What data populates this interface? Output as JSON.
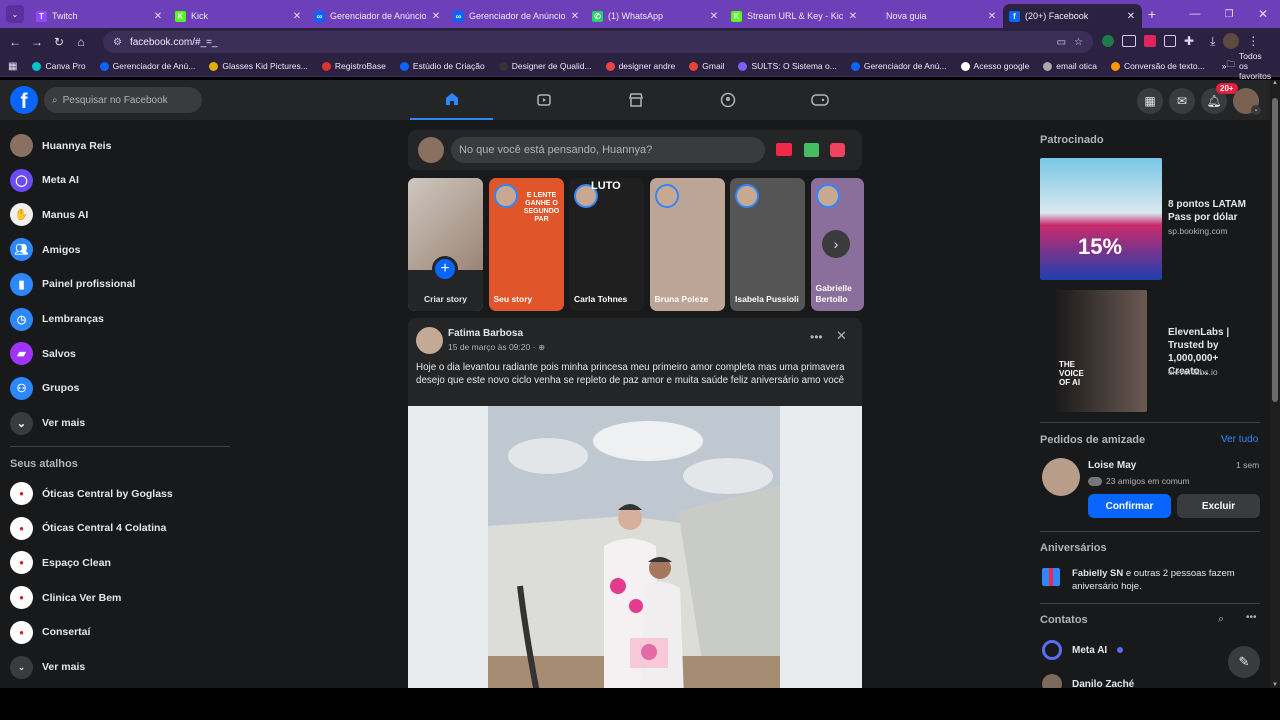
{
  "browser": {
    "tabs": [
      {
        "title": "Twitch",
        "icon_color": "#9146ff",
        "icon": "T"
      },
      {
        "title": "Kick",
        "icon_color": "#53fc18",
        "icon": "K"
      },
      {
        "title": "Gerenciador de Anúncios",
        "icon_color": "#0866ff",
        "icon": "∞"
      },
      {
        "title": "Gerenciador de Anúncios",
        "icon_color": "#0866ff",
        "icon": "∞"
      },
      {
        "title": "(1) WhatsApp",
        "icon_color": "#25d366",
        "icon": "✆"
      },
      {
        "title": "Stream URL & Key - Kick",
        "icon_color": "#53fc18",
        "icon": "K"
      },
      {
        "title": "Nova guia",
        "icon_color": "#6d3fb8",
        "icon": ""
      },
      {
        "title": "(20+) Facebook",
        "icon_color": "#0866ff",
        "icon": "f"
      }
    ],
    "url": "facebook.com/#_=_",
    "bookmarks": [
      {
        "label": "Canva Pro",
        "color": "#00c4cc"
      },
      {
        "label": "Gerenciador de Anú...",
        "color": "#0866ff"
      },
      {
        "label": "Glasses Kid Pictures...",
        "color": "#e0b000"
      },
      {
        "label": "RegistroBase",
        "color": "#d33"
      },
      {
        "label": "Estúdio de Criação",
        "color": "#0866ff"
      },
      {
        "label": "Designer de Qualid...",
        "color": "#333"
      },
      {
        "label": "designer andre",
        "color": "#e44"
      },
      {
        "label": "Gmail",
        "color": "#ea4335"
      },
      {
        "label": "SULTS: O Sistema o...",
        "color": "#7b61ff"
      },
      {
        "label": "Gerenciador de Anú...",
        "color": "#0866ff"
      },
      {
        "label": "Acesso google",
        "color": "#fff"
      },
      {
        "label": "email otica",
        "color": "#aaa"
      },
      {
        "label": "Conversão de texto...",
        "color": "#f90"
      }
    ],
    "bookmarks_more": "»",
    "all_favorites": "Todos os favoritos"
  },
  "facebook": {
    "search_placeholder": "Pesquisar no Facebook",
    "notification_count": "20+",
    "sidebar": [
      {
        "label": "Huannya Reis",
        "icon": "avatar",
        "color": "#8a7060"
      },
      {
        "label": "Meta AI",
        "icon": "meta-ai-icon",
        "color": "#6b4cf6"
      },
      {
        "label": "Manus AI",
        "icon": "manus-icon",
        "color": "#f0f0f0"
      },
      {
        "label": "Amigos",
        "icon": "friends-icon",
        "color": "#2d88ff"
      },
      {
        "label": "Painel profissional",
        "icon": "dashboard-icon",
        "color": "#2d88ff"
      },
      {
        "label": "Lembranças",
        "icon": "memories-icon",
        "color": "#2d88ff"
      },
      {
        "label": "Salvos",
        "icon": "saved-icon",
        "color": "#a033ff"
      },
      {
        "label": "Grupos",
        "icon": "groups-icon",
        "color": "#2d88ff"
      },
      {
        "label": "Ver mais",
        "icon": "chevron-down-icon",
        "color": "#3a3b3c"
      }
    ],
    "shortcuts_title": "Seus atalhos",
    "shortcuts": [
      {
        "label": "Óticas Central by Goglass",
        "color": "#fff"
      },
      {
        "label": "Óticas Central 4 Colatina",
        "color": "#fff"
      },
      {
        "label": "Espaço Clean",
        "color": "#fff"
      },
      {
        "label": "Clinica Ver Bem",
        "color": "#fff"
      },
      {
        "label": "Consertaí",
        "color": "#fff"
      },
      {
        "label": "Ver mais",
        "color": "#3a3b3c"
      }
    ],
    "composer_placeholder": "No que você está pensando, Huannya?",
    "stories": [
      {
        "name": "Criar story",
        "bg": "#d8d2cc"
      },
      {
        "name": "Seu story",
        "bg": "#e0562a"
      },
      {
        "name": "Carla Tohnes",
        "bg": "#1f1f1f"
      },
      {
        "name": "Bruna Poleze",
        "bg": "#bda596"
      },
      {
        "name": "Isabela Pussioli",
        "bg": "#555"
      },
      {
        "name": "Gabrielle Bertollo",
        "bg": "#8a6f9c"
      }
    ],
    "story_overlay": {
      "seu_story_text": "E LENTE GANHE O SEGUNDO PAR",
      "carla_title": "LUTO"
    },
    "post": {
      "author": "Fatima Barbosa",
      "date": "15 de março às 09:20 ·",
      "text": "Hoje o dia levantou radiante pois minha princesa meu primeiro amor completa mas uma primavera desejo que este novo ciclo venha se repleto de paz amor e muita saúde feliz aniversário amo você"
    },
    "right": {
      "sponsored_title": "Patrocinado",
      "ads": [
        {
          "title": "8 pontos LATAM Pass por dólar",
          "domain": "sp.booking.com",
          "promo": "15%"
        },
        {
          "title": "ElevenLabs | Trusted by 1,000,000+ Creato...",
          "domain": "elevenlabs.io",
          "promo": "THE VOICE OF AI"
        }
      ],
      "friend_requests_title": "Pedidos de amizade",
      "see_all": "Ver tudo",
      "request": {
        "name": "Loise May",
        "time": "1 sem",
        "mutual": "23 amigos em comum",
        "confirm": "Confirmar",
        "delete": "Excluir"
      },
      "birthdays_title": "Aniversários",
      "birthday_name": "Fabielly SN",
      "birthday_text": " e outras 2 pessoas fazem aniversário hoje.",
      "contacts_title": "Contatos",
      "contacts": [
        "Meta AI",
        "Danilo Zaché"
      ]
    }
  }
}
